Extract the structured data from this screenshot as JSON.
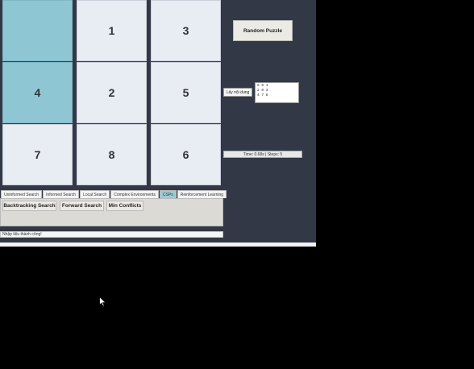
{
  "puzzle": {
    "tiles": [
      "",
      "1",
      "3",
      "4",
      "2",
      "5",
      "7",
      "8",
      "6"
    ]
  },
  "controls": {
    "random_label": "Random Puzzle",
    "input_label": "Lấy nội dung",
    "input_lines": [
      "5 6 1",
      "2 0 3",
      "4 7 8"
    ],
    "time_text": "Time: 0.68s | Steps: 5"
  },
  "tabs": [
    "Uninformed Search",
    "Informed Search",
    "Local Search",
    "Complex Environments",
    "CSPs",
    "Reinforcement Learning"
  ],
  "active_tab": "CSPs",
  "algorithms": [
    "Backtracking Search",
    "Forward Search",
    "Min Conflicts"
  ],
  "status_text": "Nhập liệu thành công!",
  "colors": {
    "background": "#323845",
    "tile": "#e8ecf3",
    "highlight_tile": "#8fc6d4",
    "active_tab": "#9bcbd6"
  }
}
